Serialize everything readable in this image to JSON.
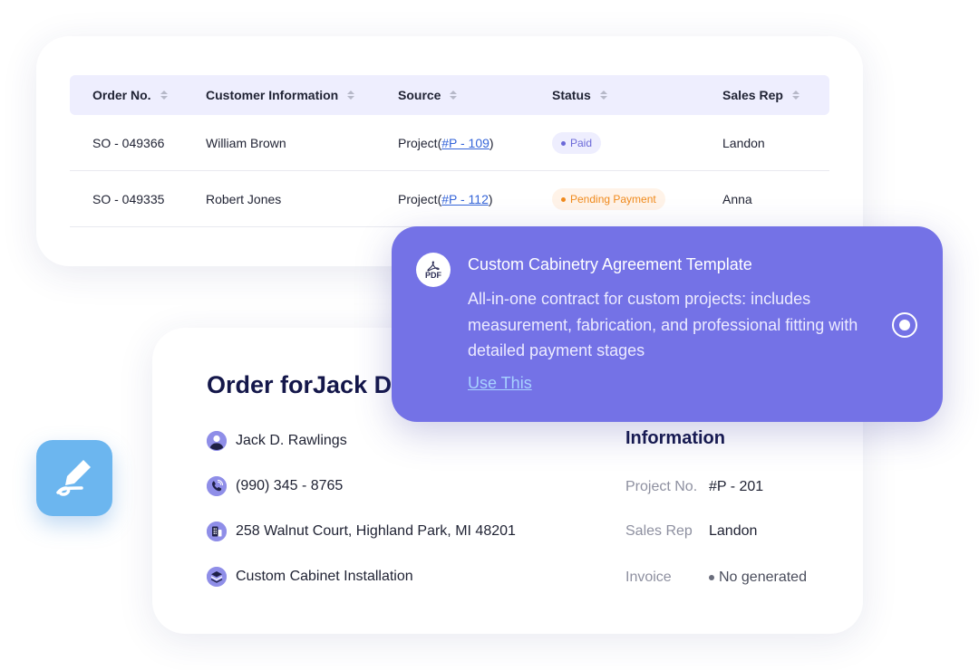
{
  "orders": {
    "columns": [
      "Order No.",
      "Customer Information",
      "Source",
      "Status",
      "Sales Rep"
    ],
    "rows": [
      {
        "order_no": "SO - 049366",
        "customer": "William Brown",
        "source_prefix": "Project(",
        "source_link": "#P - 109",
        "source_suffix": ")",
        "status": "Paid",
        "sales_rep": "Landon"
      },
      {
        "order_no": "SO - 049335",
        "customer": "Robert Jones",
        "source_prefix": "Project(",
        "source_link": "#P - 112",
        "source_suffix": ")",
        "status": "Pending Payment",
        "sales_rep": "Anna"
      }
    ]
  },
  "order_detail": {
    "title": "Order forJack D",
    "customer_name": "Jack D. Rawlings",
    "phone": "(990) 345 - 8765",
    "address": "258 Walnut Court, Highland Park, MI 48201",
    "service": "Custom Cabinet Installation",
    "info_heading": "Information",
    "info": {
      "project_no_label": "Project No.",
      "project_no": "#P - 201",
      "sales_rep_label": "Sales Rep",
      "sales_rep": "Landon",
      "invoice_label": "Invoice",
      "invoice": "No generated"
    }
  },
  "template_popup": {
    "icon_label": "PDF",
    "title": "Custom Cabinetry Agreement Template",
    "description": "All-in-one contract for custom projects: includes measurement, fabrication, and professional fitting with detailed payment stages",
    "action": "Use This"
  },
  "colors": {
    "accent": "#7472e6",
    "paid": "#6b69d8",
    "pending": "#f08a1c",
    "link": "#3565d9",
    "edit_app": "#6cb6ef"
  }
}
